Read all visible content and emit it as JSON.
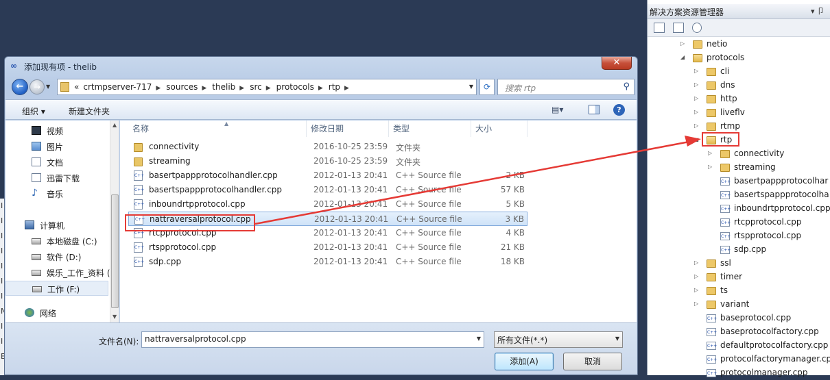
{
  "dialog": {
    "title": "添加现有项 - thelib",
    "breadcrumb": [
      "«",
      "crtmpserver-717",
      "sources",
      "thelib",
      "src",
      "protocols",
      "rtp"
    ],
    "search_placeholder": "搜索 rtp",
    "toolbar": {
      "organize": "组织 ▾",
      "new_folder": "新建文件夹",
      "views": "▤▾"
    },
    "nav": [
      {
        "label": "视频",
        "icon": "video-icon"
      },
      {
        "label": "图片",
        "icon": "picture-icon"
      },
      {
        "label": "文档",
        "icon": "document-icon"
      },
      {
        "label": "迅雷下载",
        "icon": "download-icon"
      },
      {
        "label": "音乐",
        "icon": "music-icon"
      },
      {
        "label": "计算机",
        "icon": "computer-icon"
      },
      {
        "label": "本地磁盘 (C:)",
        "icon": "disk-icon"
      },
      {
        "label": "软件 (D:)",
        "icon": "disk-icon"
      },
      {
        "label": "娱乐_工作_资料 (",
        "icon": "disk-icon"
      },
      {
        "label": "工作 (F:)",
        "icon": "disk-icon"
      },
      {
        "label": "网络",
        "icon": "network-icon"
      }
    ],
    "columns": {
      "name": "名称",
      "date": "修改日期",
      "type": "类型",
      "size": "大小"
    },
    "files": [
      {
        "name": "connectivity",
        "date": "2016-10-25 23:59",
        "type": "文件夹",
        "size": "",
        "kind": "folder"
      },
      {
        "name": "streaming",
        "date": "2016-10-25 23:59",
        "type": "文件夹",
        "size": "",
        "kind": "folder"
      },
      {
        "name": "basertpappprotocolhandler.cpp",
        "date": "2012-01-13 20:41",
        "type": "C++ Source file",
        "size": "2 KB",
        "kind": "cpp"
      },
      {
        "name": "basertspappprotocolhandler.cpp",
        "date": "2012-01-13 20:41",
        "type": "C++ Source file",
        "size": "57 KB",
        "kind": "cpp"
      },
      {
        "name": "inboundrtpprotocol.cpp",
        "date": "2012-01-13 20:41",
        "type": "C++ Source file",
        "size": "5 KB",
        "kind": "cpp"
      },
      {
        "name": "nattraversalprotocol.cpp",
        "date": "2012-01-13 20:41",
        "type": "C++ Source file",
        "size": "3 KB",
        "kind": "cpp"
      },
      {
        "name": "rtcpprotocol.cpp",
        "date": "2012-01-13 20:41",
        "type": "C++ Source file",
        "size": "4 KB",
        "kind": "cpp"
      },
      {
        "name": "rtspprotocol.cpp",
        "date": "2012-01-13 20:41",
        "type": "C++ Source file",
        "size": "21 KB",
        "kind": "cpp"
      },
      {
        "name": "sdp.cpp",
        "date": "2012-01-13 20:41",
        "type": "C++ Source file",
        "size": "18 KB",
        "kind": "cpp"
      }
    ],
    "filename_label": "文件名(N):",
    "filename_value": "nattraversalprotocol.cpp",
    "filetype_value": "所有文件(*.*)",
    "add_button": "添加(A)",
    "cancel_button": "取消"
  },
  "solution_explorer": {
    "title": "解决方案资源管理器",
    "title_buttons": "▾ 卩",
    "tree": [
      {
        "label": "netio",
        "kind": "fold",
        "depth": 1,
        "arrow": "▷"
      },
      {
        "label": "protocols",
        "kind": "open",
        "depth": 1,
        "arrow": "◢"
      },
      {
        "label": "cli",
        "kind": "fold",
        "depth": 2,
        "arrow": "▷"
      },
      {
        "label": "dns",
        "kind": "fold",
        "depth": 2,
        "arrow": "▷"
      },
      {
        "label": "http",
        "kind": "fold",
        "depth": 2,
        "arrow": "▷"
      },
      {
        "label": "liveflv",
        "kind": "fold",
        "depth": 2,
        "arrow": "▷"
      },
      {
        "label": "rtmp",
        "kind": "fold",
        "depth": 2,
        "arrow": "▷"
      },
      {
        "label": "rtp",
        "kind": "open",
        "depth": 2,
        "arrow": "◢"
      },
      {
        "label": "connectivity",
        "kind": "fold",
        "depth": 3,
        "arrow": "▷"
      },
      {
        "label": "streaming",
        "kind": "fold",
        "depth": 3,
        "arrow": "▷"
      },
      {
        "label": "basertpappprotocolhar",
        "kind": "cpp",
        "depth": 3,
        "arrow": ""
      },
      {
        "label": "basertspappprotocolha",
        "kind": "cpp",
        "depth": 3,
        "arrow": ""
      },
      {
        "label": "inboundrtpprotocol.cpp",
        "kind": "cpp",
        "depth": 3,
        "arrow": ""
      },
      {
        "label": "rtcpprotocol.cpp",
        "kind": "cpp",
        "depth": 3,
        "arrow": ""
      },
      {
        "label": "rtspprotocol.cpp",
        "kind": "cpp",
        "depth": 3,
        "arrow": ""
      },
      {
        "label": "sdp.cpp",
        "kind": "cpp",
        "depth": 3,
        "arrow": ""
      },
      {
        "label": "ssl",
        "kind": "fold",
        "depth": 2,
        "arrow": "▷"
      },
      {
        "label": "timer",
        "kind": "fold",
        "depth": 2,
        "arrow": "▷"
      },
      {
        "label": "ts",
        "kind": "fold",
        "depth": 2,
        "arrow": "▷"
      },
      {
        "label": "variant",
        "kind": "fold",
        "depth": 2,
        "arrow": "▷"
      },
      {
        "label": "baseprotocol.cpp",
        "kind": "cpp",
        "depth": 2,
        "arrow": ""
      },
      {
        "label": "baseprotocolfactory.cpp",
        "kind": "cpp",
        "depth": 2,
        "arrow": ""
      },
      {
        "label": "defaultprotocolfactory.cpp",
        "kind": "cpp",
        "depth": 2,
        "arrow": ""
      },
      {
        "label": "protocolfactorymanager.cpp",
        "kind": "cpp",
        "depth": 2,
        "arrow": ""
      },
      {
        "label": "protocolmanager.cpp",
        "kind": "cpp",
        "depth": 2,
        "arrow": ""
      }
    ]
  },
  "desk_letters": [
    "I",
    "I",
    "I",
    "I",
    "I",
    "I",
    "I",
    "N",
    "I",
    "I",
    "E"
  ],
  "colors": {
    "highlight": "#e53a35",
    "selection": "#cfe3f8",
    "accent": "#2d64b8"
  }
}
